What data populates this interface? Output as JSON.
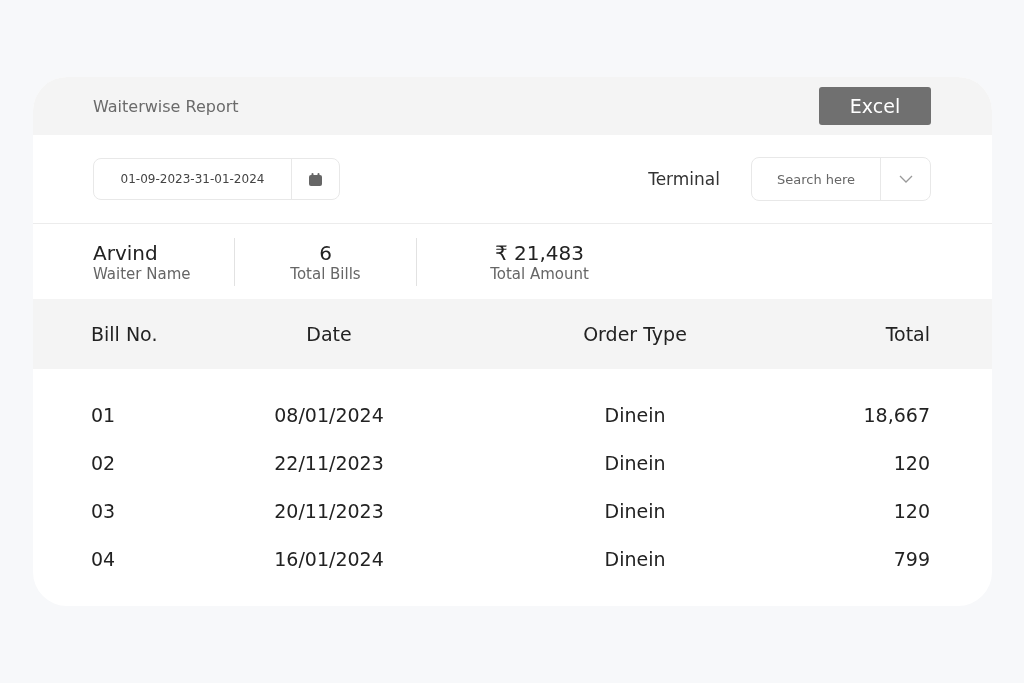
{
  "header": {
    "title": "Waiterwise Report",
    "export_button": "Excel"
  },
  "filters": {
    "date_range": "01-09-2023-31-01-2024",
    "terminal_label": "Terminal",
    "terminal_select": {
      "placeholder": "Search here"
    }
  },
  "summary": [
    {
      "value": "Arvind",
      "label": "Waiter Name"
    },
    {
      "value": "6",
      "label": "Total Bills"
    },
    {
      "value": "₹ 21,483",
      "label": "Total Amount"
    }
  ],
  "table": {
    "columns": [
      "Bill No.",
      "Date",
      "Order Type",
      "Total"
    ],
    "rows": [
      [
        "01",
        "08/01/2024",
        "Dinein",
        "18,667"
      ],
      [
        "02",
        "22/11/2023",
        "Dinein",
        "120"
      ],
      [
        "03",
        "20/11/2023",
        "Dinein",
        "120"
      ],
      [
        "04",
        "16/01/2024",
        "Dinein",
        "799"
      ]
    ]
  }
}
